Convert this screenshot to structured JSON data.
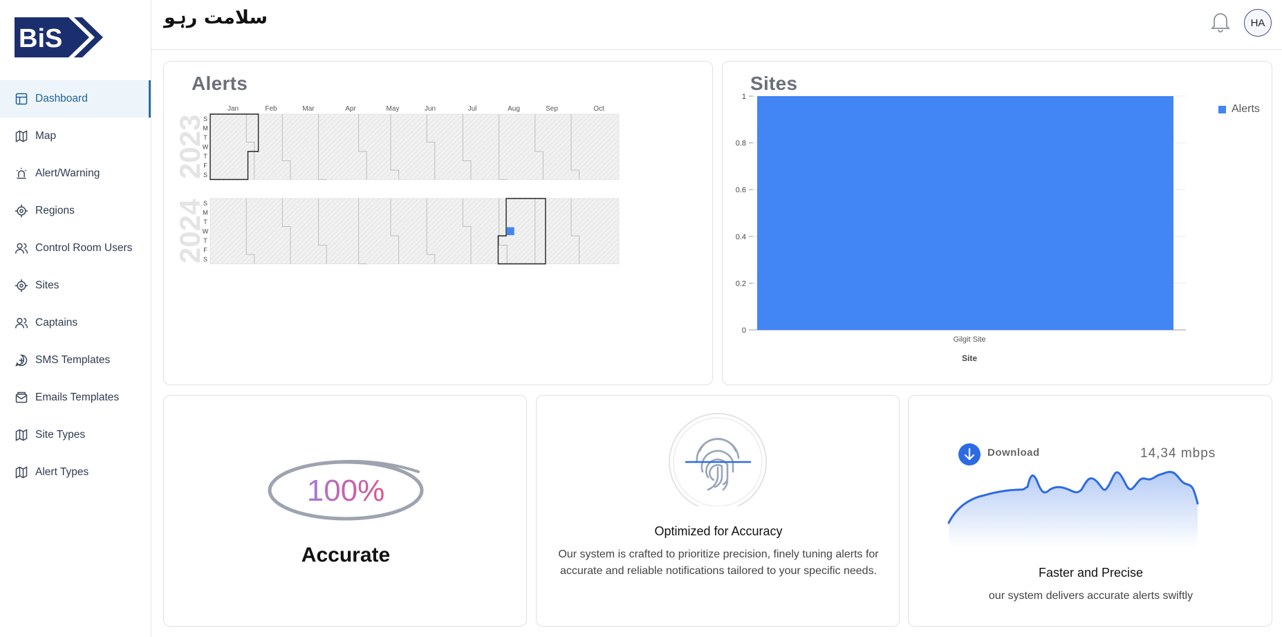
{
  "brand": {
    "logo_text": "BiS",
    "title": "سلامت رہو",
    "logo_color": "#1b2f6e"
  },
  "header": {
    "avatar_initials": "HA"
  },
  "sidebar": {
    "items": [
      {
        "label": "Dashboard",
        "icon": "layout-icon",
        "active": true
      },
      {
        "label": "Map",
        "icon": "map-icon"
      },
      {
        "label": "Alert/Warning",
        "icon": "siren-icon"
      },
      {
        "label": "Regions",
        "icon": "target-icon"
      },
      {
        "label": "Control Room Users",
        "icon": "users-icon"
      },
      {
        "label": "Sites",
        "icon": "target-icon"
      },
      {
        "label": "Captains",
        "icon": "users-icon"
      },
      {
        "label": "SMS Templates",
        "icon": "message-plus-icon"
      },
      {
        "label": "Emails Templates",
        "icon": "mail-icon"
      },
      {
        "label": "Site Types",
        "icon": "map-icon"
      },
      {
        "label": "Alert Types",
        "icon": "map-icon"
      }
    ]
  },
  "alerts_card": {
    "title": "Alerts",
    "years": [
      "2023",
      "2024"
    ],
    "months": [
      "Jan",
      "Feb",
      "Mar",
      "Apr",
      "May",
      "Jun",
      "Jul",
      "Aug",
      "Sep",
      "Oct"
    ],
    "weekdays": [
      "S",
      "M",
      "T",
      "W",
      "T",
      "F",
      "S"
    ],
    "highlight_color": "#4285f4"
  },
  "sites_card": {
    "title": "Sites",
    "legend": "Alerts",
    "chart_data": {
      "type": "bar",
      "categories": [
        "Gilgit Site"
      ],
      "series": [
        {
          "name": "Alerts",
          "values": [
            1
          ]
        }
      ],
      "xlabel": "Site",
      "ylabel": "",
      "ylim": [
        0,
        1
      ],
      "yticks": [
        "0",
        "0.2",
        "0.4",
        "0.6",
        "0.8",
        "1"
      ],
      "color": "#4285f4",
      "legend_position": "top-right"
    }
  },
  "accuracy_card": {
    "percent": "100%",
    "label": "Accurate"
  },
  "optimized_card": {
    "icon": "fingerprint-icon",
    "title": "Optimized for Accuracy",
    "description": "Our system is crafted to prioritize precision, finely tuning alerts for accurate and reliable notifications tailored to your specific needs."
  },
  "speed_card": {
    "download_label": "Download",
    "speed_value": "14,34 mbps",
    "title": "Faster and Precise",
    "description": "our system delivers accurate alerts swiftly",
    "accent": "#2d6be4"
  }
}
